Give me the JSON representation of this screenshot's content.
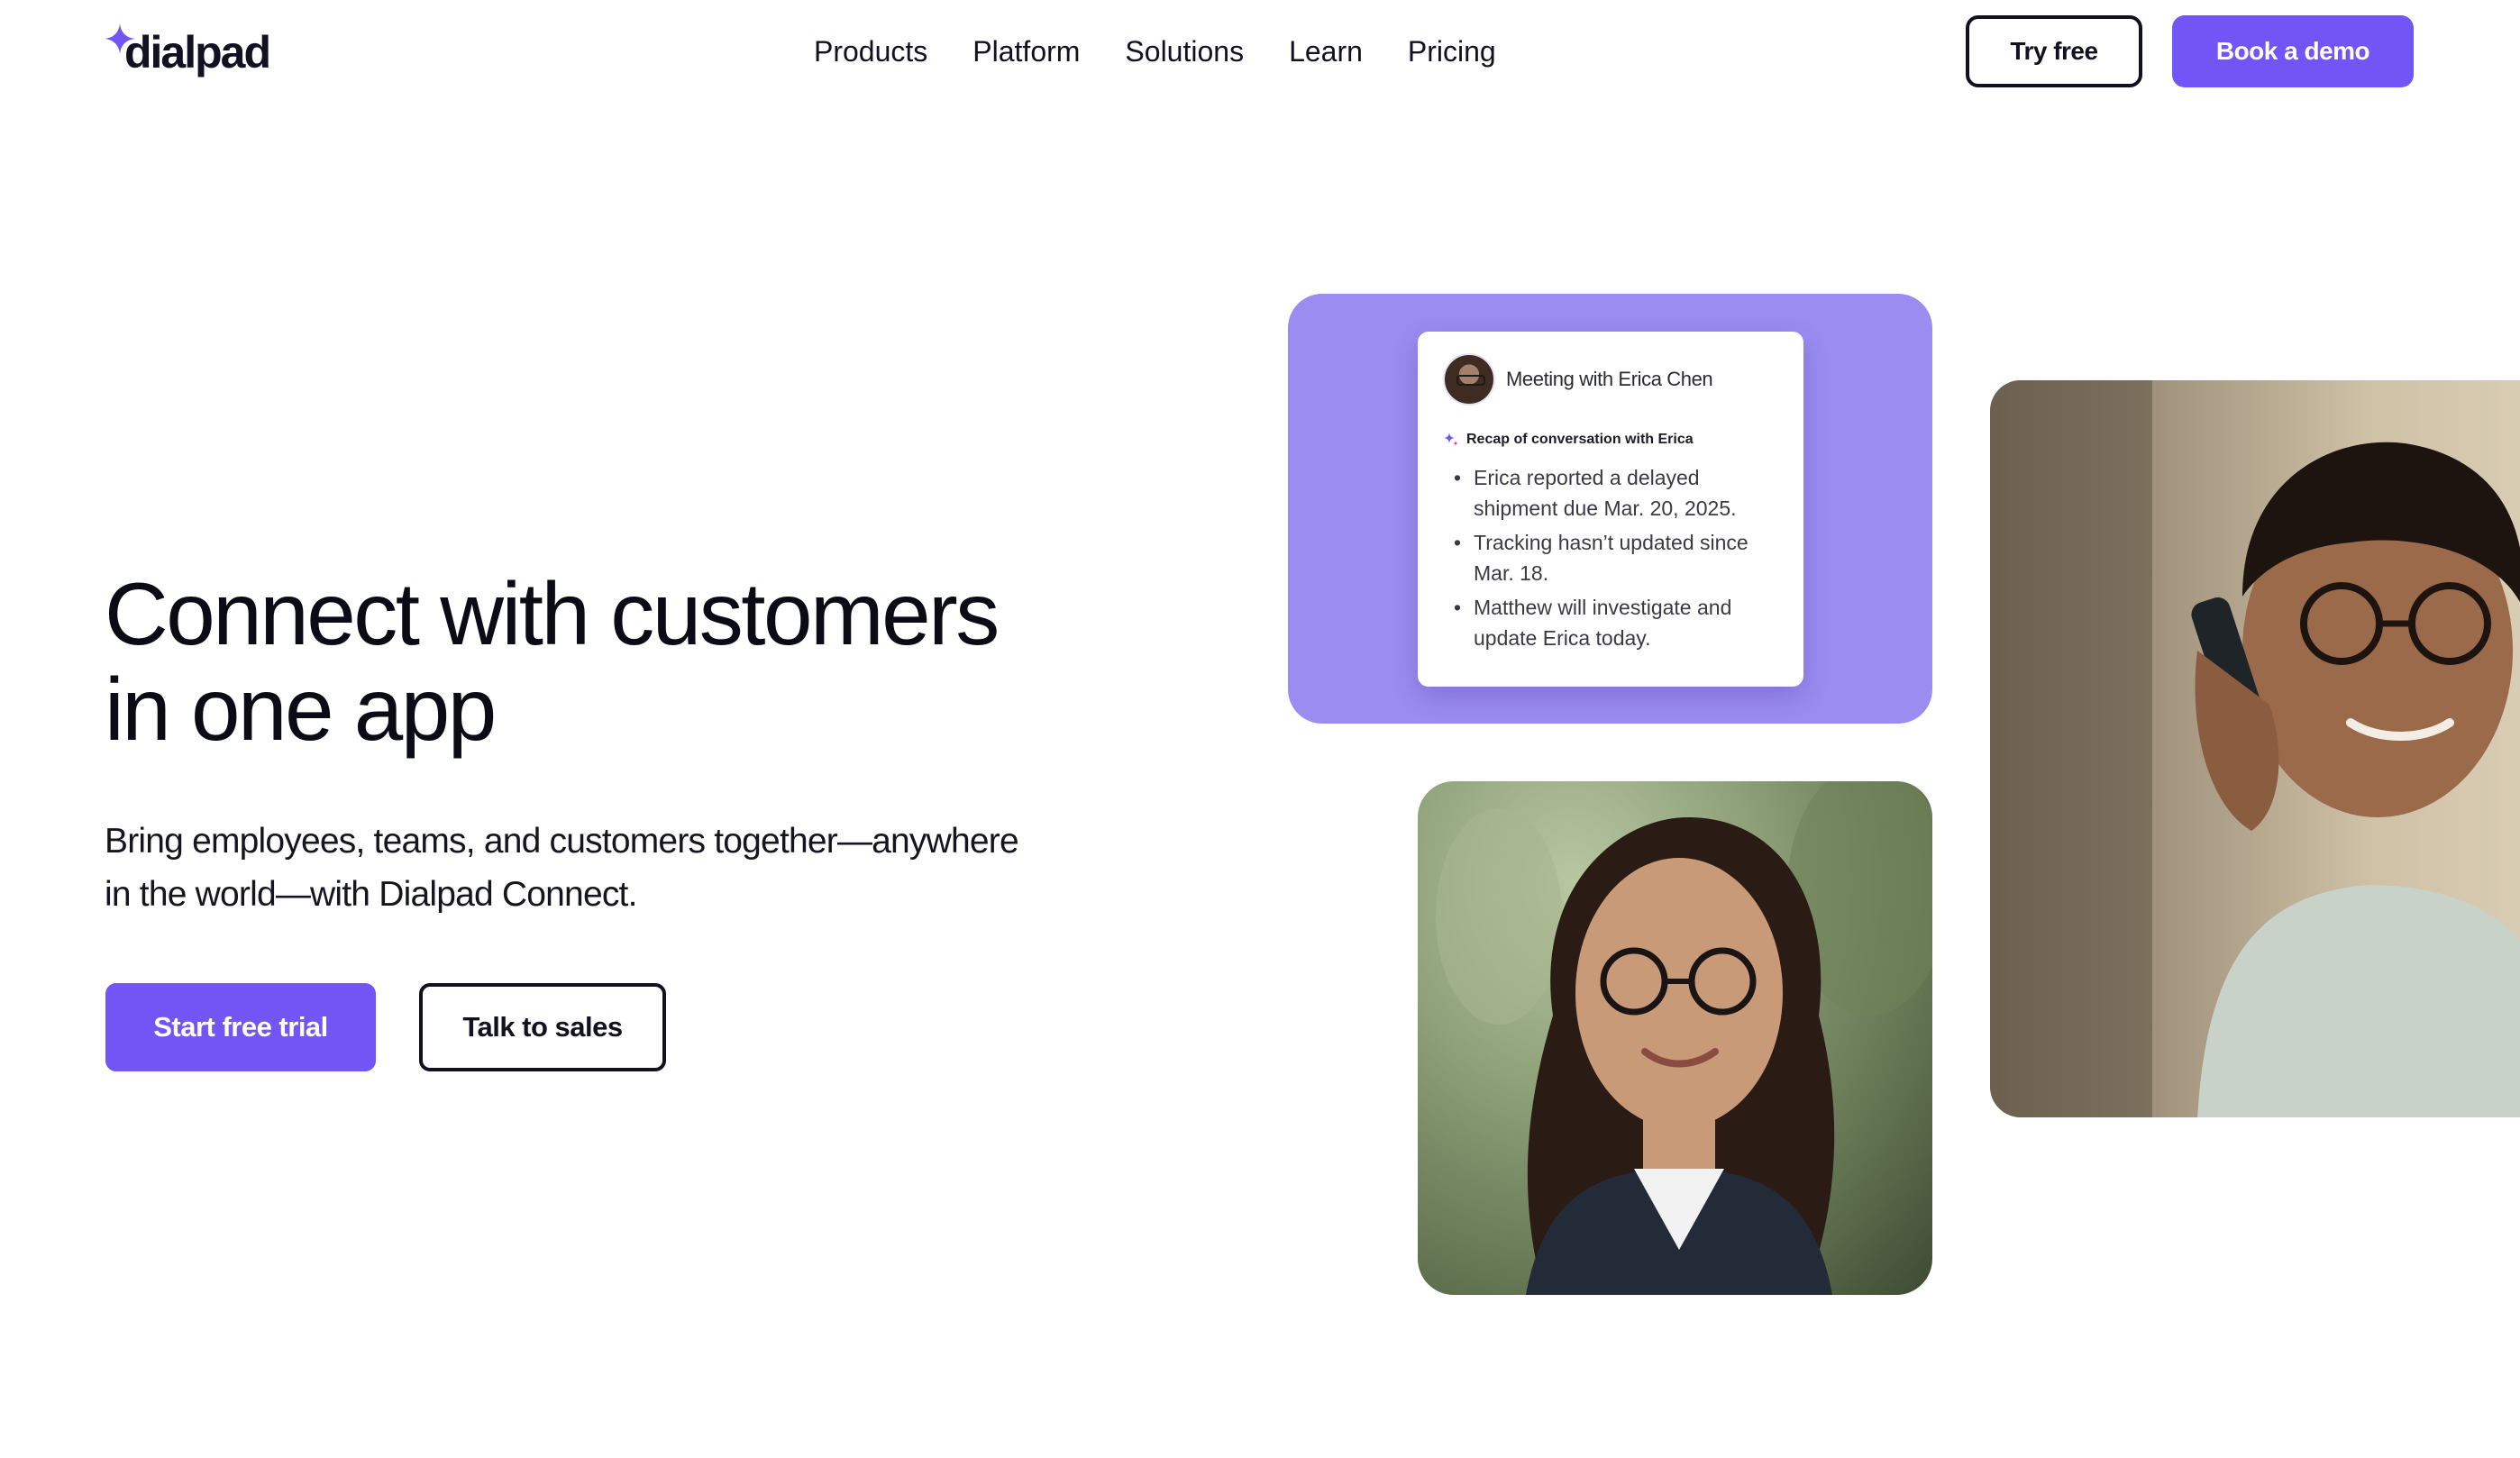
{
  "header": {
    "logo": {
      "text": "dialpad",
      "icon": "sparkle-icon",
      "accent": "#7155f5"
    },
    "nav": [
      "Products",
      "Platform",
      "Solutions",
      "Learn",
      "Pricing"
    ],
    "try_free": "Try free",
    "book_demo": "Book a demo"
  },
  "hero": {
    "title_line1": "Connect with customers",
    "title_line2": "in one app",
    "subtitle_line1": "Bring employees, teams, and customers together—anywhere",
    "subtitle_line2": "in the world—with Dialpad Connect.",
    "cta_primary": "Start free trial",
    "cta_secondary": "Talk to sales"
  },
  "meeting_card": {
    "title": "Meeting with Erica Chen",
    "recap_label": "Recap of conversation with Erica",
    "items": [
      "Erica reported a delayed shipment due Mar. 20, 2025.",
      "Tracking hasn’t updated since Mar. 18.",
      "Matthew will investigate and update Erica today."
    ]
  },
  "colors": {
    "brand": "#7155f5",
    "panel": "#9b8cf2",
    "text": "#111122"
  }
}
